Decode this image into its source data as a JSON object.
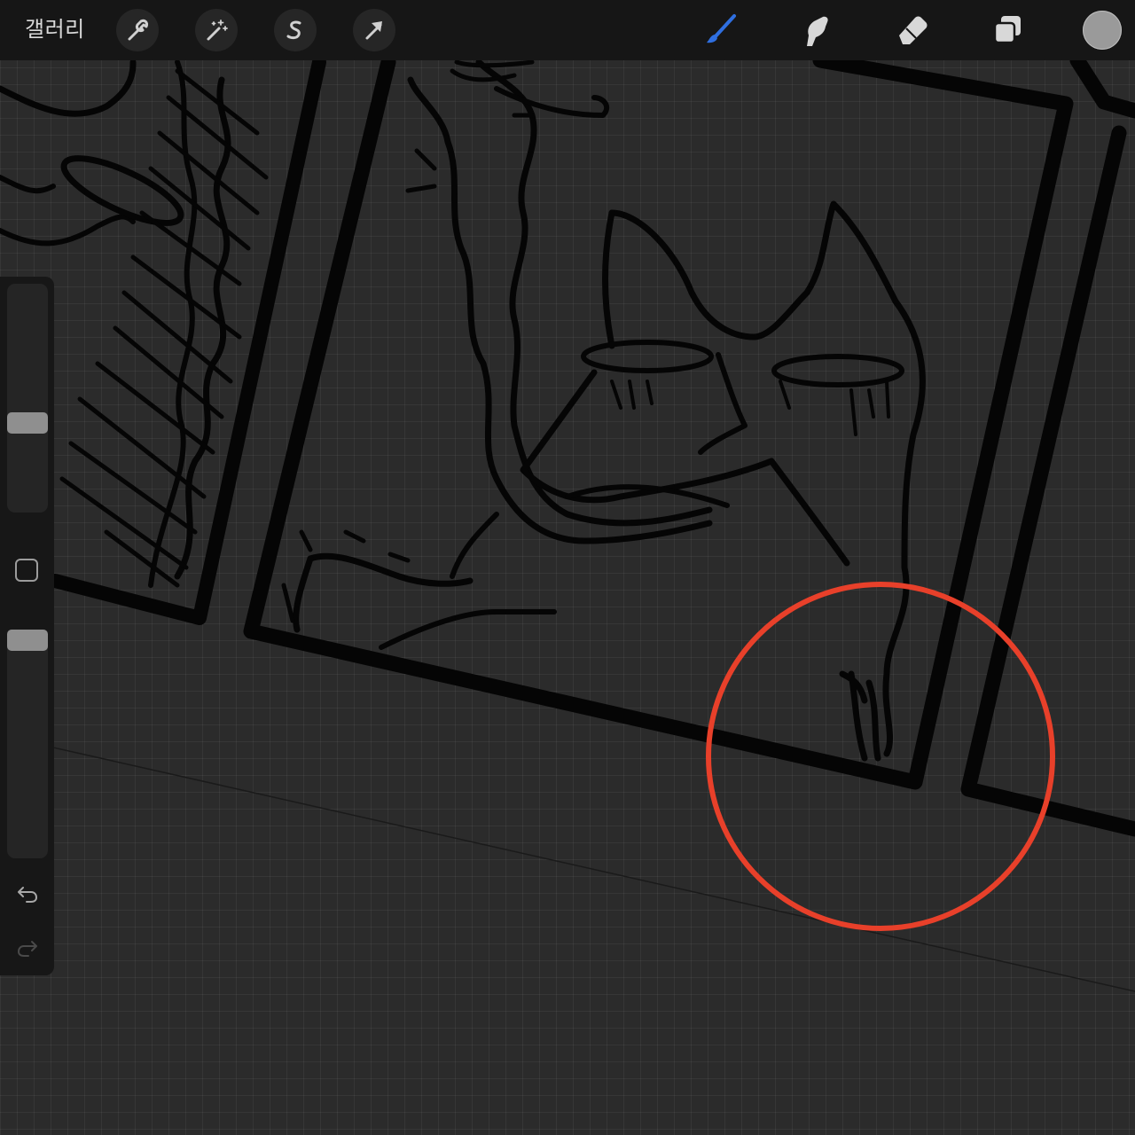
{
  "app": {
    "gallery_label": "갤러리"
  },
  "toolbar_left": [
    {
      "name": "actions",
      "icon": "wrench-icon"
    },
    {
      "name": "adjustments",
      "icon": "magic-wand-icon"
    },
    {
      "name": "selection",
      "icon": "selection-s-icon"
    },
    {
      "name": "transform",
      "icon": "transform-arrow-icon"
    }
  ],
  "toolbar_right": [
    {
      "name": "brush",
      "icon": "brush-icon",
      "active": true
    },
    {
      "name": "smudge",
      "icon": "smudge-finger-icon",
      "active": false
    },
    {
      "name": "eraser",
      "icon": "eraser-icon",
      "active": false
    },
    {
      "name": "layers",
      "icon": "layers-icon",
      "active": false
    }
  ],
  "current_color": "#9a9a9a",
  "accent_color": "#2f6fe0",
  "annotation_color": "#e8402a",
  "sidebar": {
    "brush_size_level": 0.38,
    "opacity_level": 1.0,
    "modify_icon": "square-modify-icon",
    "undo_icon": "undo-icon",
    "redo_icon": "redo-icon"
  }
}
